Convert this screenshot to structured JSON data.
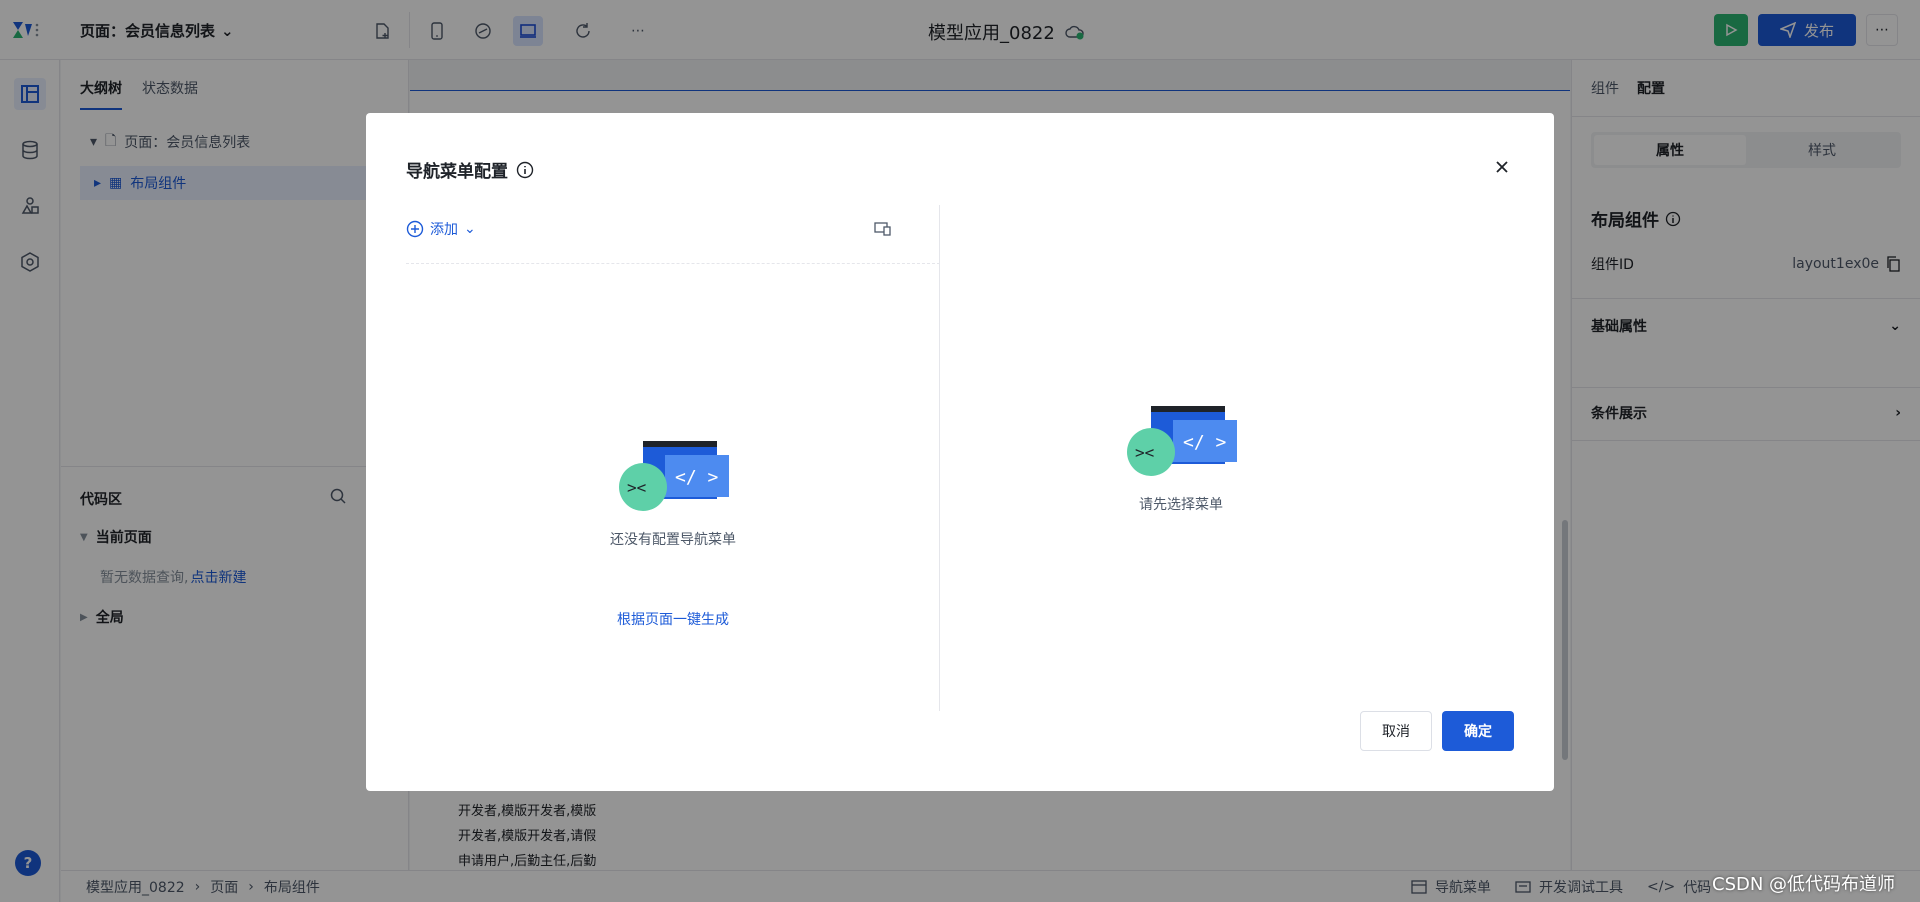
{
  "topbar": {
    "page_select": "页面：会员信息列表",
    "app_title": "模型应用_0822",
    "publish_label": "发布",
    "icons": [
      "add-page-icon",
      "mobile-icon",
      "web-icon",
      "desktop-icon",
      "refresh-icon",
      "more-icon",
      "cloud-saved-icon",
      "play-icon",
      "send-icon"
    ]
  },
  "left_panel": {
    "tabs": [
      "大纲树",
      "状态数据"
    ],
    "tree": [
      {
        "label": "页面：会员信息列表"
      },
      {
        "label": "布局组件"
      }
    ],
    "code_area": {
      "title": "代码区",
      "current_page": "当前页面",
      "empty_text": "暂无数据查询,",
      "new_link": "点击新建",
      "global": "全局"
    }
  },
  "canvas": {
    "lines": [
      "开发者,模版开发者,模版",
      "开发者,模版开发者,请假",
      "申请用户,后勤主任,后勤"
    ]
  },
  "right_panel": {
    "tabs": [
      "组件",
      "配置"
    ],
    "segments": [
      "属性",
      "样式"
    ],
    "heading": "布局组件",
    "component_id_label": "组件ID",
    "component_id_value": "layout1ex0e",
    "basic_props": "基础属性",
    "condition": "条件展示"
  },
  "statusbar": {
    "crumbs": [
      "模型应用_0822",
      "页面",
      "布局组件"
    ],
    "tools": [
      "导航菜单",
      "开发调试工具",
      "代码"
    ]
  },
  "modal": {
    "title": "导航菜单配置",
    "add_label": "添加",
    "empty_left": "还没有配置导航菜单",
    "generate_link": "根据页面一键生成",
    "empty_right": "请先选择菜单",
    "cancel_label": "取消",
    "ok_label": "确定"
  },
  "watermark": "CSDN @低代码布道师",
  "colors": {
    "primary": "#1d5bd8",
    "success": "#2bb673"
  }
}
